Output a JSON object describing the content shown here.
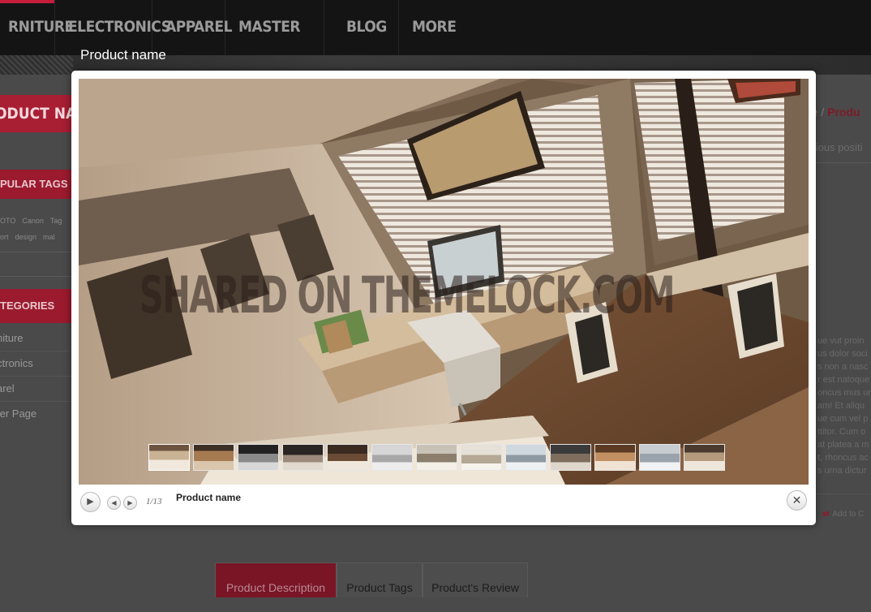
{
  "nav": {
    "items": [
      "RNITURE",
      "ELECTRONICS",
      "APPAREL",
      "MASTER PAGE",
      "BLOG",
      "MORE COLOR"
    ]
  },
  "sidebar": {
    "page_title": "ODUCT NAME",
    "popular_tags": {
      "title": "PULAR TAGS",
      "tags_row1": [
        "OTO",
        "Canon",
        "Tag"
      ],
      "tags_row2": [
        "ort",
        "design",
        "mal"
      ]
    },
    "categories": {
      "title": "TEGORIES",
      "items": [
        "niture",
        "ctronics",
        "arel",
        "ter Page"
      ]
    }
  },
  "breadcrumb": {
    "prefix": "re / ",
    "current": "Produ"
  },
  "previous_position": "evious positi",
  "description_lines": [
    "ue vut proin",
    "us dolor soci",
    "s non a nasc",
    "r est natoque",
    "oncus mus ur",
    "am! Et aliqu",
    "ue cum vel p",
    "ttitor. Cum o",
    "at platea a m",
    "t, rhoncus ac",
    "s urna dictur"
  ],
  "add_to": "Add to C",
  "tabs": [
    "Product Description",
    "Product Tags",
    "Product's Review"
  ],
  "lightbox": {
    "title": "Product name",
    "caption": "Product name",
    "counter": "1/13",
    "watermark": "SHARED ON THEMELOCK.COM",
    "thumbnail_count": 13,
    "controls": {
      "play": "play-icon",
      "prev": "arrow-left-icon",
      "next": "arrow-right-icon",
      "close": "close-icon"
    }
  },
  "colors": {
    "accent": "#c41e3a",
    "nav_bg": "#141414",
    "overlay_bg": "#4a4a4a",
    "modal_bg": "#ffffff"
  }
}
